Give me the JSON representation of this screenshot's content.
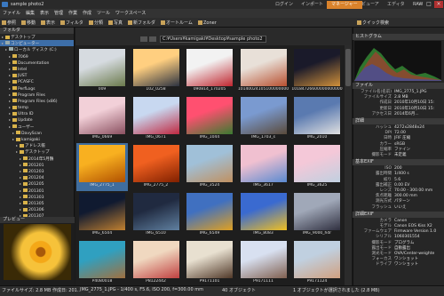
{
  "app": {
    "title": "sample photo2"
  },
  "modes": [
    {
      "label": "ログイン"
    },
    {
      "label": "インポート"
    },
    {
      "label": "マネージャー",
      "active": true
    },
    {
      "label": "ビューア"
    },
    {
      "label": "エディタ"
    },
    {
      "label": "RAW"
    }
  ],
  "menus": [
    "ファイル",
    "編集",
    "表示",
    "管理",
    "作業",
    "作成",
    "ツール",
    "ワークスペース"
  ],
  "toolbar": {
    "items": [
      {
        "label": "参照"
      },
      {
        "label": "移動"
      },
      {
        "label": "表示"
      },
      {
        "label": "フィルタ"
      },
      {
        "label": "分類"
      },
      {
        "label": "写真"
      },
      {
        "label": "新フォルダ"
      },
      {
        "label": "オートルーム"
      },
      {
        "label": "Zoner"
      }
    ],
    "right": [
      {
        "label": "クイック検索"
      }
    ]
  },
  "left_pane": {
    "title": "フォルダ",
    "tree": [
      {
        "label": "デスクトップ",
        "kind": "folder"
      },
      {
        "label": "コンピューター",
        "kind": "drive",
        "sel": true
      },
      {
        "label": "ローカル ディスク (C:)",
        "kind": "drive"
      },
      {
        "label": "7069",
        "kind": "folder"
      },
      {
        "label": "Documentation",
        "kind": "folder"
      },
      {
        "label": "Intel",
        "kind": "folder"
      },
      {
        "label": "JUST",
        "kind": "folder"
      },
      {
        "label": "PCASFC",
        "kind": "folder"
      },
      {
        "label": "PerfLogs",
        "kind": "folder"
      },
      {
        "label": "Program Files",
        "kind": "folder"
      },
      {
        "label": "Program Files (x86)",
        "kind": "folder"
      },
      {
        "label": "temp",
        "kind": "folder"
      },
      {
        "label": "Ultra ID",
        "kind": "folder"
      },
      {
        "label": "Update",
        "kind": "folder"
      },
      {
        "label": "ユーザー",
        "kind": "folder"
      },
      {
        "label": "DavyScan",
        "kind": "folder"
      },
      {
        "label": "kamigaki",
        "kind": "folder"
      },
      {
        "label": "アドレス帳",
        "kind": "folder"
      },
      {
        "label": "デスクトップ",
        "kind": "folder"
      },
      {
        "label": "2014年5月鶴",
        "kind": "folder"
      },
      {
        "label": "201201",
        "kind": "folder"
      },
      {
        "label": "201203",
        "kind": "folder"
      },
      {
        "label": "201204",
        "kind": "folder"
      },
      {
        "label": "201205",
        "kind": "folder"
      },
      {
        "label": "201301",
        "kind": "folder"
      },
      {
        "label": "201303",
        "kind": "folder"
      },
      {
        "label": "201305",
        "kind": "folder"
      },
      {
        "label": "201306",
        "kind": "folder"
      },
      {
        "label": "201307",
        "kind": "folder"
      },
      {
        "label": "201308",
        "kind": "folder"
      }
    ]
  },
  "preview": {
    "label": "プレビュー"
  },
  "path": "C:¥Users¥kamigaki¥Desktop¥sample photo2",
  "thumbnails": [
    {
      "name": "009",
      "c1": "#d6dbe0",
      "c2": "#6b7a4c"
    },
    {
      "name": "102_0258",
      "c1": "#ffcf80",
      "c2": "#2c3240"
    },
    {
      "name": "090814_170205",
      "c1": "#f2f2f2",
      "c2": "#c0262f"
    },
    {
      "name": "10140024105100000000",
      "c1": "#e8e0d8",
      "c2": "#b85030"
    },
    {
      "name": "10184726600000000000",
      "c1": "#1a1a2a",
      "c2": "#d0903a"
    },
    {
      "name": "IMG_0669",
      "c1": "#f2d0d8",
      "c2": "#8a5060"
    },
    {
      "name": "IMG_0671",
      "c1": "#c8d8f0",
      "c2": "#c02840"
    },
    {
      "name": "IMG_1044",
      "c1": "#ff5070",
      "c2": "#3a7a30"
    },
    {
      "name": "IMG_1703_s",
      "c1": "#7a9ad0",
      "c2": "#5a4a3a"
    },
    {
      "name": "IMG_2010",
      "c1": "#5a7ab0",
      "c2": "#e0e0e0"
    },
    {
      "name": "IMG_2775_1",
      "c1": "#f8b020",
      "c2": "#b05000",
      "sel": true
    },
    {
      "name": "IMG_2775_2",
      "c1": "#f06020",
      "c2": "#802000"
    },
    {
      "name": "IMG_3524",
      "c1": "#a0c0d8",
      "c2": "#c09060"
    },
    {
      "name": "IMG_3617",
      "c1": "#f0c0d0",
      "c2": "#5a8ad0"
    },
    {
      "name": "IMG_3625",
      "c1": "#f4c8d8",
      "c2": "#c0d0e0"
    },
    {
      "name": "IMG_6504",
      "c1": "#101a30",
      "c2": "#c08030"
    },
    {
      "name": "IMG_6510",
      "c1": "#202a40",
      "c2": "#6080a0"
    },
    {
      "name": "IMG_6549",
      "c1": "#4070c0",
      "c2": "#e0a020"
    },
    {
      "name": "IMG_8083",
      "c1": "#3a6ad0",
      "c2": "#f0c020"
    },
    {
      "name": "IMG_9000_hdr",
      "c1": "#a0a8b8",
      "c2": "#303040"
    },
    {
      "name": "P4080018",
      "c1": "#30a0c0",
      "c2": "#a07040"
    },
    {
      "name": "P8122442",
      "c1": "#f0d8c0",
      "c2": "#c04040"
    },
    {
      "name": "P9171101",
      "c1": "#e8e0d0",
      "c2": "#503828"
    },
    {
      "name": "P9171111",
      "c1": "#d8e0f0",
      "c2": "#806050"
    },
    {
      "name": "P9171124",
      "c1": "#c0d0e0",
      "c2": "#d0a080"
    }
  ],
  "right_pane": {
    "histogram_title": "ヒストグラム",
    "file_title": "ファイル",
    "file_rows": [
      {
        "k": "ファイル名(名前)",
        "v": "IMG_2775_1.JPG"
      },
      {
        "k": "ファイルサイズ",
        "v": "2.8 MB"
      },
      {
        "k": "作成日",
        "v": "2010年10月10日 15:"
      },
      {
        "k": "更新日",
        "v": "2010年10月10日 15:"
      },
      {
        "k": "アクセス日",
        "v": "2014年6月..."
      }
    ],
    "detail_title": "詳細",
    "detail_rows": [
      {
        "k": "ハッシュ",
        "v": "4272x2848x24"
      },
      {
        "k": "DPI",
        "v": "72.00"
      },
      {
        "k": "日時",
        "v": "JFIF 圧縮"
      },
      {
        "k": "カラー",
        "v": "sRGB"
      },
      {
        "k": "圧縮率",
        "v": "ファイン"
      },
      {
        "k": "撮影モード",
        "v": "未定義"
      }
    ],
    "exif_title": "基本EXIF",
    "exif_rows": [
      {
        "k": "ISO",
        "v": "200"
      },
      {
        "k": "露出時間",
        "v": "1/400 s"
      },
      {
        "k": "絞り",
        "v": "5.6"
      },
      {
        "k": "露出補正",
        "v": "0.00 EV"
      },
      {
        "k": "レンズ",
        "v": "70.00 - 300.00 mm"
      },
      {
        "k": "焦点距離",
        "v": "300.00 mm"
      },
      {
        "k": "測光方式",
        "v": "パターン"
      },
      {
        "k": "フラッシュ",
        "v": "いいえ"
      }
    ],
    "exif2_title": "詳細EXIF",
    "exif2_rows": [
      {
        "k": "カメラ",
        "v": "Canon"
      },
      {
        "k": "モデル",
        "v": "Canon EOS Kiss X2"
      },
      {
        "k": "ファームウェア",
        "v": "Firmware Version 1.0"
      },
      {
        "k": "シリアル",
        "v": "1060301554"
      },
      {
        "k": "撮影モード",
        "v": "プログラム"
      },
      {
        "k": "露出モード",
        "v": "自動露出"
      },
      {
        "k": "測光モード",
        "v": "OVA/Center-weighte"
      },
      {
        "k": "フォーカス",
        "v": "ワンショット"
      },
      {
        "k": "ドライブ",
        "v": "ワンショット"
      }
    ]
  },
  "status": {
    "left": "ファイルサイズ: 2.8 MB  作成日: 201...",
    "dims": "4272 x 2848 x 24  解像度: 72...",
    "mid": "IMG_2775_1.JPG - 1/400 s, F5.6, ISO 200, f=300.00 mm",
    "count": "40 オブジェクト",
    "sel": "1 オブジェクトが選択されました (2.8 MB)"
  },
  "colors": {
    "accent": "#d9822b",
    "selection": "#3d6ea8"
  }
}
